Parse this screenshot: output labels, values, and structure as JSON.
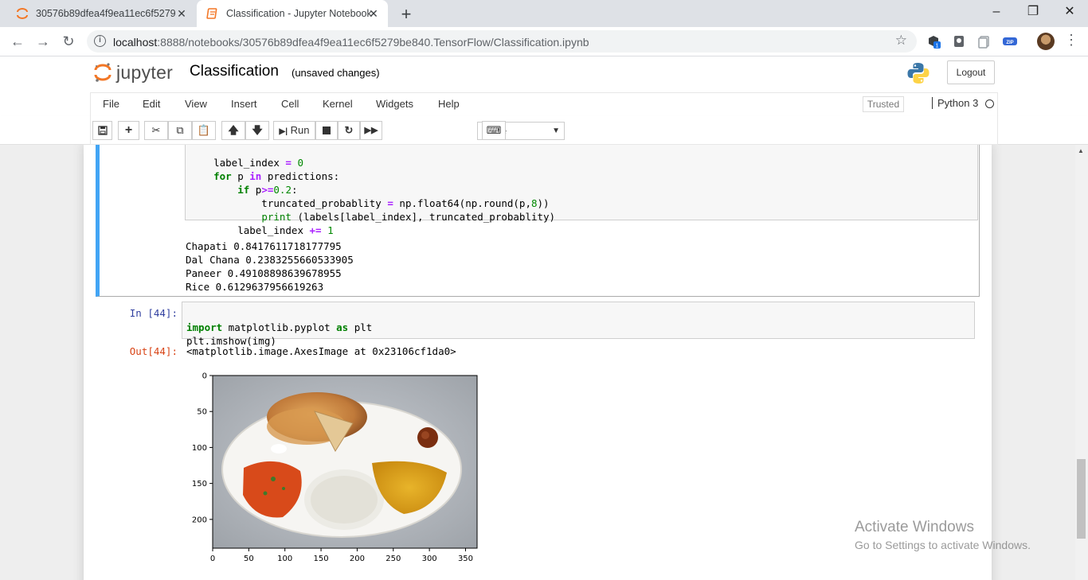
{
  "browser": {
    "tabs": [
      {
        "title": "30576b89dfea4f9ea11ec6f5279be840",
        "active": false
      },
      {
        "title": "Classification - Jupyter Notebook",
        "active": true
      }
    ],
    "new_tab": "+",
    "url_host": "localhost",
    "url_rest": ":8888/notebooks/30576b89dfea4f9ea11ec6f5279be840.TensorFlow/Classification.ipynb",
    "window_controls": {
      "minimize": "–",
      "maximize": "❐",
      "close": "✕"
    }
  },
  "jupyter": {
    "logo_text": "jupyter",
    "notebook_name": "Classification",
    "save_status": "(unsaved changes)",
    "logout_label": "Logout",
    "menu": [
      "File",
      "Edit",
      "View",
      "Insert",
      "Cell",
      "Kernel",
      "Widgets",
      "Help"
    ],
    "trusted_label": "Trusted",
    "kernel_name": "Python 3",
    "run_label": "Run",
    "cell_type": "Code"
  },
  "cells": {
    "cell1_code": [
      "    label_index = 0",
      "    for p in predictions:",
      "        if p>=0.2:",
      "            truncated_probablity = np.float64(np.round(p,8))",
      "            print (labels[label_index], truncated_probablity)",
      "        label_index += 1"
    ],
    "cell1_output": [
      "Chapati 0.8417611718177795",
      "Dal Chana 0.2383255660533905",
      "Paneer 0.49108898639678955",
      "Rice 0.6129637956619263"
    ],
    "cell2_prompt": "In [44]:",
    "cell2_code": [
      "import matplotlib.pyplot as plt",
      "plt.imshow(img)"
    ],
    "cell2_out_prompt": "Out[44]:",
    "cell2_output": "<matplotlib.image.AxesImage at 0x23106cf1da0>"
  },
  "chart_data": {
    "type": "image",
    "x_ticks": [
      "0",
      "50",
      "100",
      "150",
      "200",
      "250",
      "300",
      "350"
    ],
    "y_ticks": [
      "0",
      "50",
      "100",
      "150",
      "200"
    ],
    "xlim": [
      0,
      366
    ],
    "ylim": [
      240,
      0
    ]
  },
  "watermark": {
    "line1": "Activate Windows",
    "line2": "Go to Settings to activate Windows."
  }
}
